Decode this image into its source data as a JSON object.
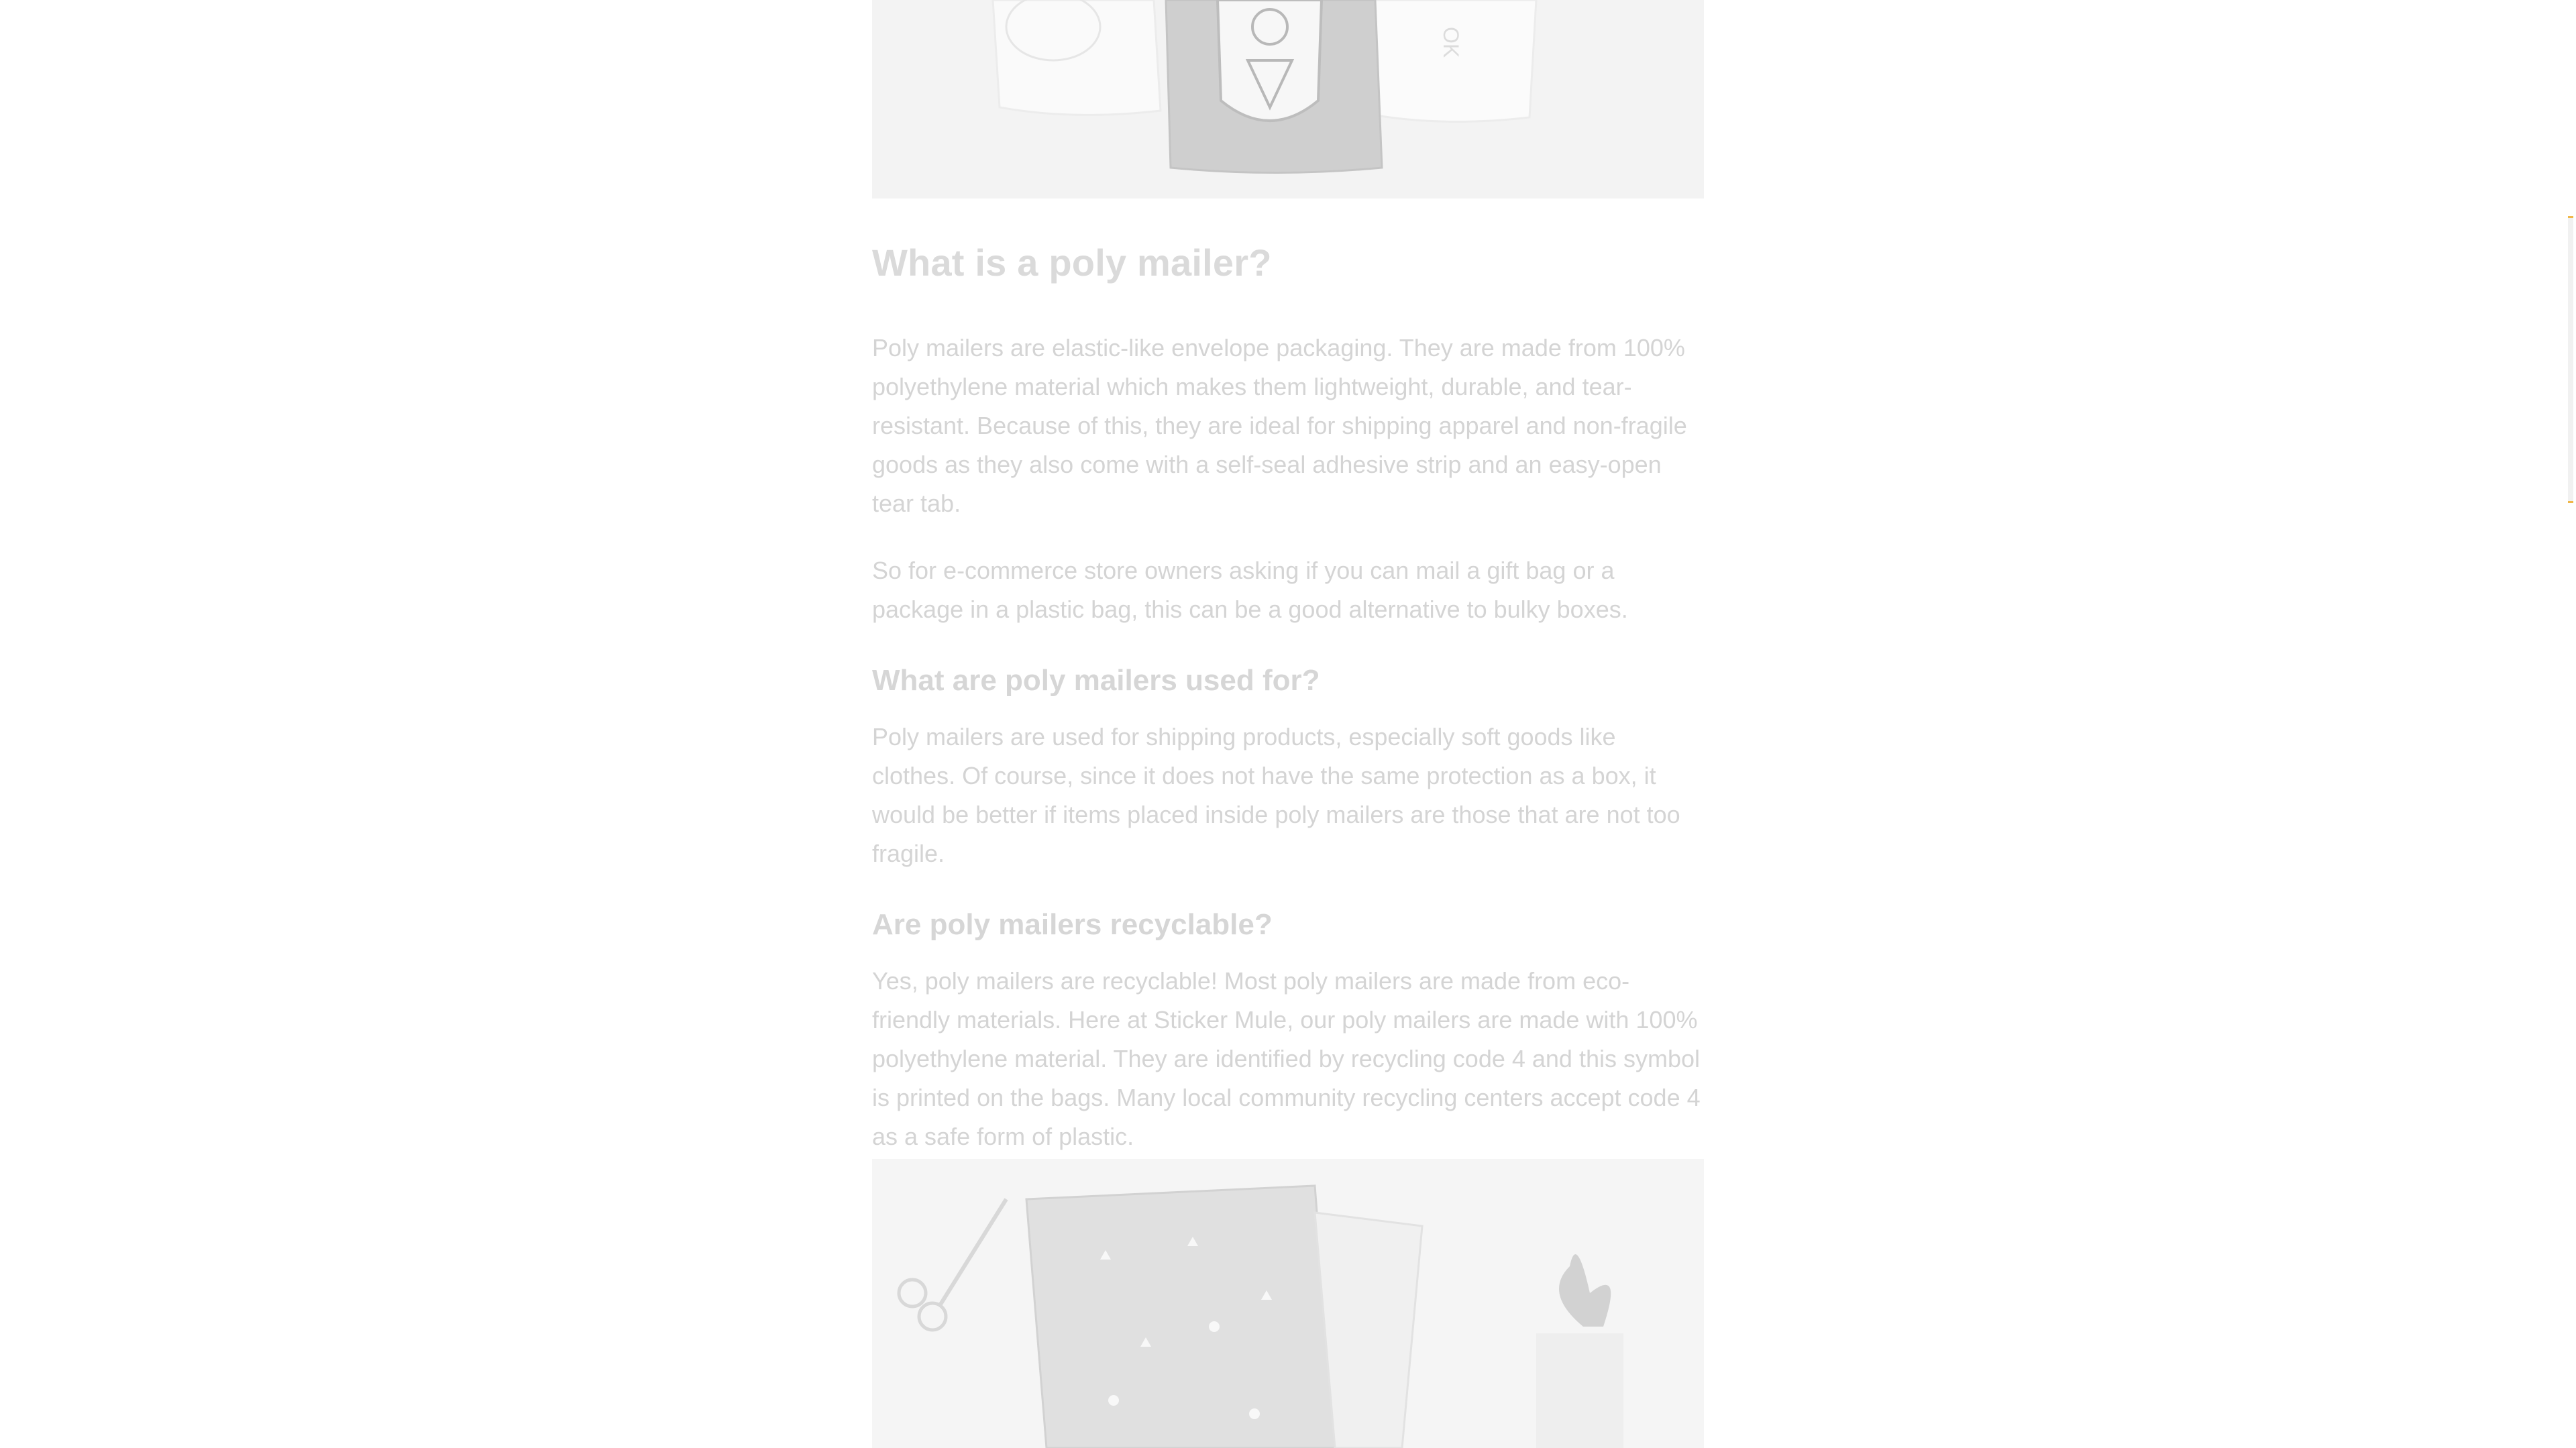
{
  "article": {
    "sections": [
      {
        "heading": "What is a poly mailer?",
        "paragraphs": [
          "Poly mailers are elastic-like envelope packaging. They are made from 100% polyethylene material which makes them lightweight, durable, and tear-resistant. Because of this, they are ideal for shipping apparel and non-fragile goods as they also come with a self-seal adhesive strip and an easy-open tear tab.",
          "So for e-commerce store owners asking if you can mail a gift bag or a package in a plastic bag, this can be a good alternative to bulky boxes."
        ]
      },
      {
        "heading": "What are poly mailers used for?",
        "paragraphs": [
          "Poly mailers are used for shipping products, especially soft goods like clothes. Of course, since it does not have the same protection as a box, it would be better if items placed inside poly mailers are those that are not too fragile."
        ]
      },
      {
        "heading": "Are poly mailers recyclable?",
        "paragraphs": [
          "Yes, poly mailers are recyclable! Most poly mailers are made from eco-friendly materials. Here at Sticker Mule, our poly mailers are made with 100% polyethylene material. They are identified by recycling code 4 and this symbol is printed on the bags. Many local community recycling centers accept code 4 as a safe form of plastic."
        ]
      }
    ]
  },
  "colors": {
    "heading": "#dadada",
    "body_text": "#d4d4d4",
    "scroll_accent": "#f0b84a"
  }
}
